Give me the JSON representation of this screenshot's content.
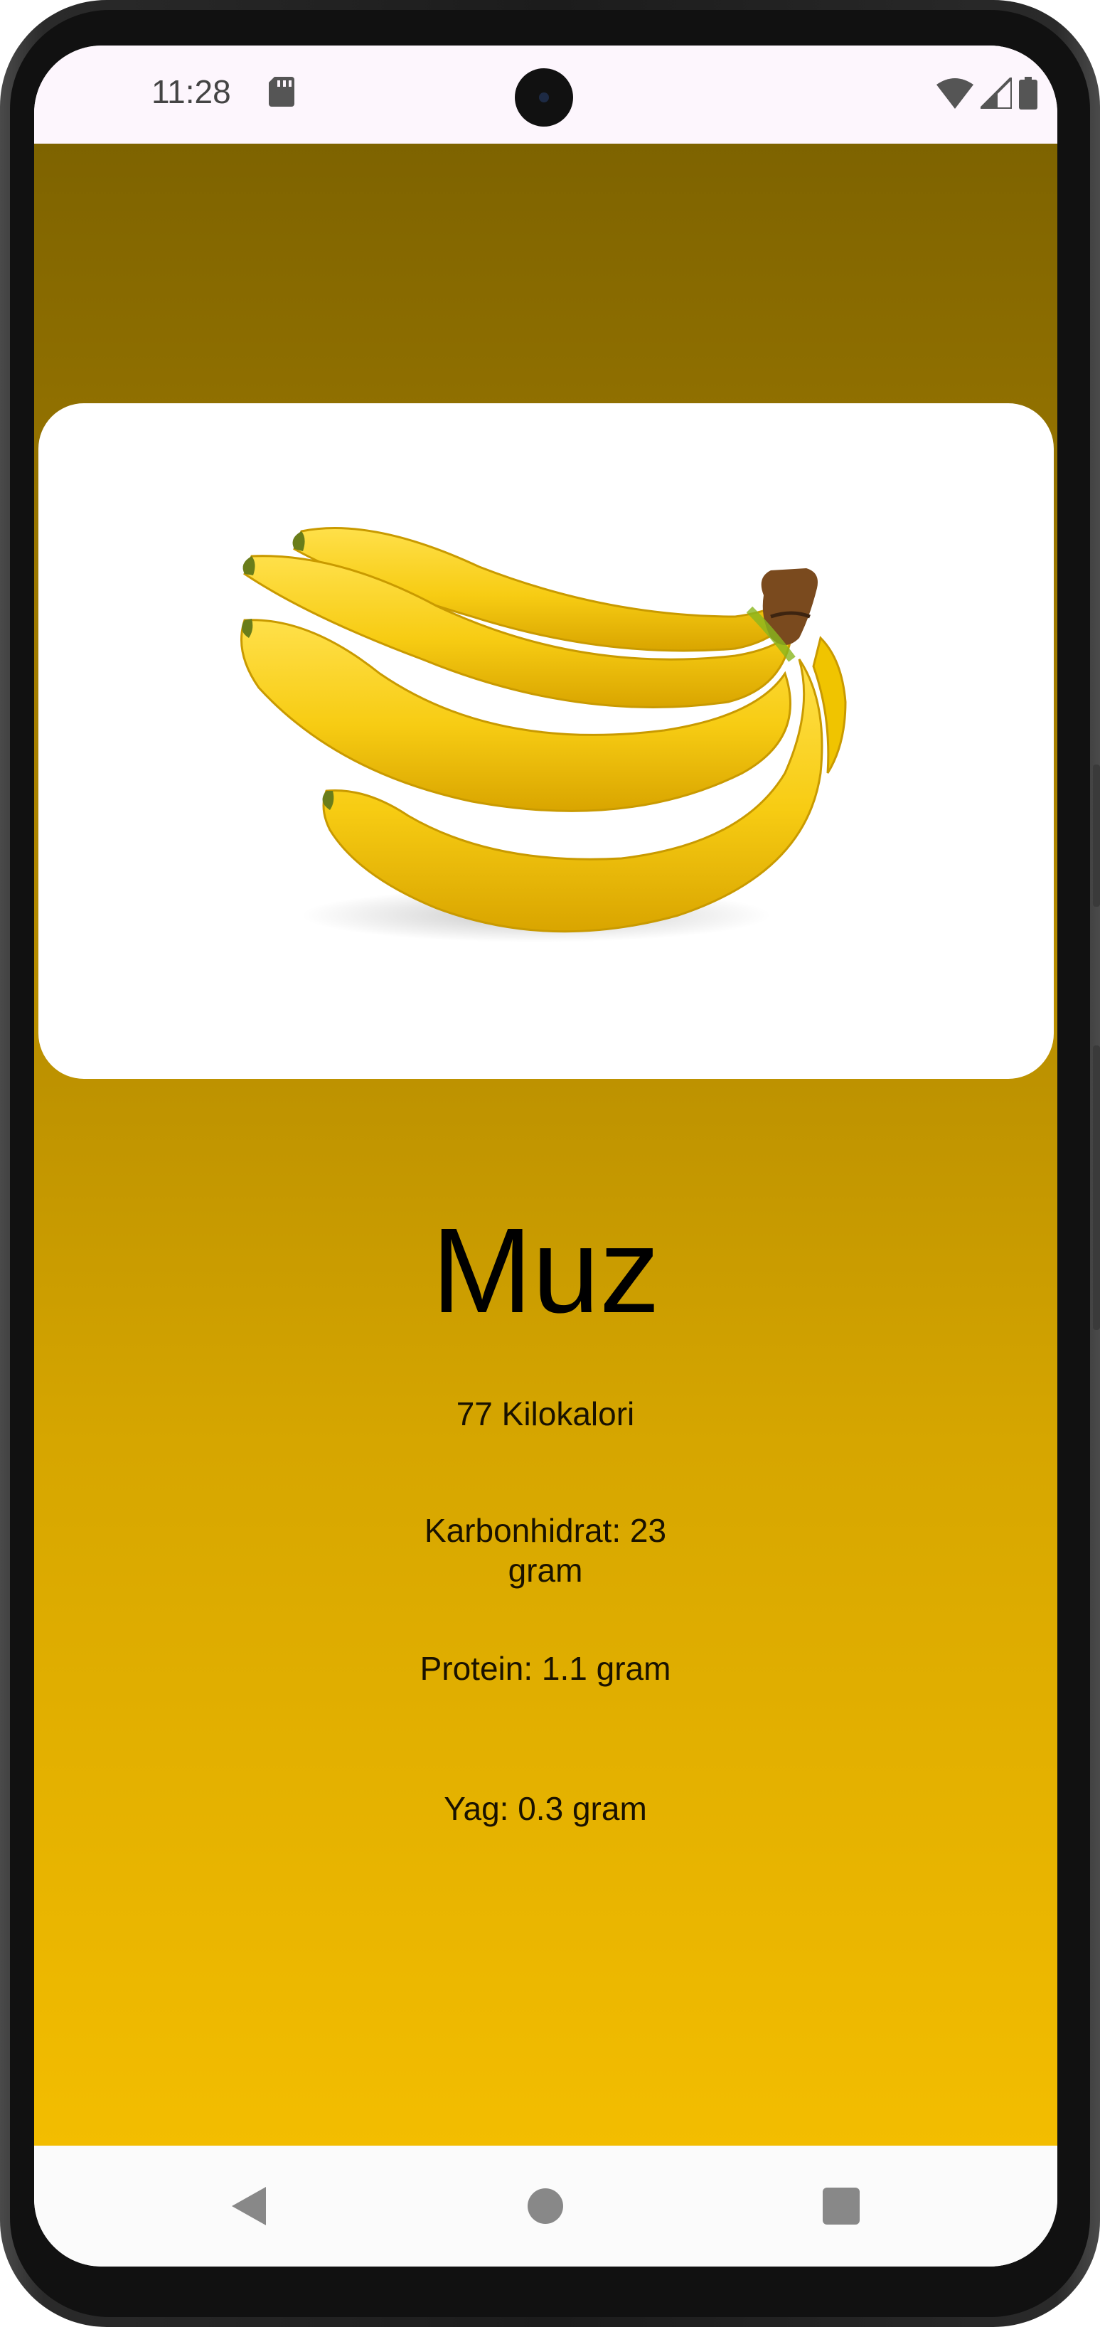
{
  "status_bar": {
    "time": "11:28",
    "icons": [
      "sd-card-icon",
      "wifi-icon",
      "cellular-signal-icon",
      "battery-icon"
    ]
  },
  "food": {
    "image": "banana-bunch-image",
    "name": "Muz",
    "calories": "77 Kilokalori",
    "carbohydrate": "Karbonhidrat: 23 gram",
    "protein": "Protein: 1.1 gram",
    "fat": "Yag: 0.3 gram"
  },
  "nav_bar": {
    "icons": [
      "back-icon",
      "home-icon",
      "recents-icon"
    ]
  },
  "colors": {
    "background_top": "#7e6300",
    "background_bottom": "#f3bd00",
    "status_bar": "#fdf6fd",
    "card": "#ffffff",
    "text": "#000000"
  }
}
